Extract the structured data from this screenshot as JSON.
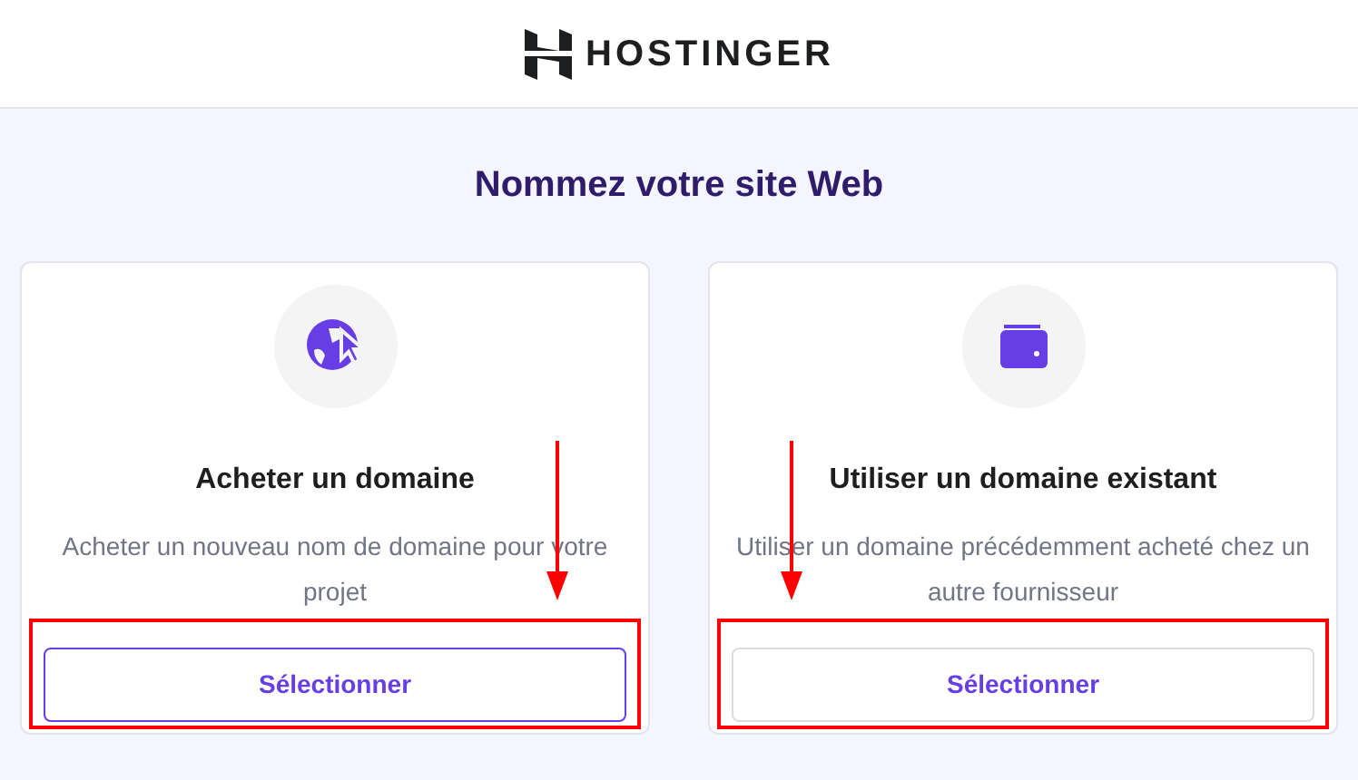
{
  "header": {
    "brand": "HOSTINGER"
  },
  "title": "Nommez votre site Web",
  "options": [
    {
      "kind": "globe",
      "title": "Acheter un domaine",
      "description": "Acheter un nouveau nom de domaine pour votre projet",
      "button": "Sélectionner",
      "highlighted": true,
      "annotated": true
    },
    {
      "kind": "wallet",
      "title": "Utiliser un domaine existant",
      "description": "Utiliser un domaine précédemment acheté chez un autre fournisseur",
      "button": "Sélectionner",
      "highlighted": false,
      "annotated": true
    }
  ]
}
